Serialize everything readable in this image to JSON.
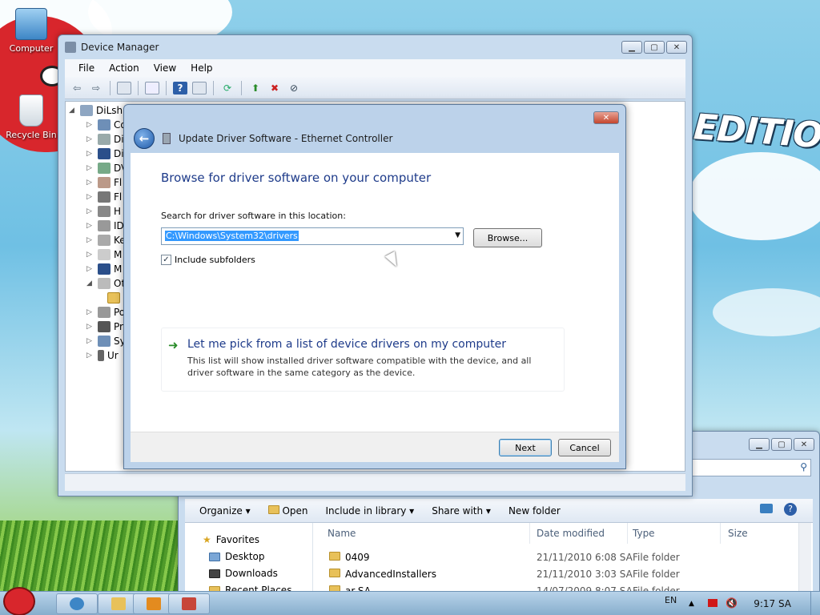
{
  "desktop": {
    "icons": [
      {
        "label": "Computer"
      },
      {
        "label": "Recycle Bin"
      }
    ],
    "wallpaper_text": "EDITION"
  },
  "device_manager": {
    "title": "Device Manager",
    "menu": [
      "File",
      "Action",
      "View",
      "Help"
    ],
    "root_label": "DiLsh",
    "tree_items": [
      "Co",
      "Di",
      "Di",
      "DV",
      "Fl",
      "Fl",
      "H",
      "ID",
      "Ke",
      "M",
      "M",
      "Ot",
      "",
      "Po",
      "Pr",
      "Sy",
      "Ur"
    ]
  },
  "dialog": {
    "title": "Update Driver Software - Ethernet Controller",
    "heading": "Browse for driver software on your computer",
    "search_label": "Search for driver software in this location:",
    "path_value": "C:\\Windows\\System32\\drivers",
    "browse_label": "Browse...",
    "include_subfolders_label": "Include subfolders",
    "include_subfolders_checked": true,
    "pick_link_title": "Let me pick from a list of device drivers on my computer",
    "pick_link_desc": "This list will show installed driver software compatible with the device, and all driver software in the same category as the device.",
    "next_label": "Next",
    "cancel_label": "Cancel"
  },
  "explorer": {
    "commands": [
      "Organize",
      "Open",
      "Include in library",
      "Share with",
      "New folder"
    ],
    "nav": [
      {
        "label": "Favorites"
      },
      {
        "label": "Desktop"
      },
      {
        "label": "Downloads"
      },
      {
        "label": "Recent Places"
      }
    ],
    "columns": [
      "Name",
      "Date modified",
      "Type",
      "Size"
    ],
    "rows": [
      {
        "name": "0409",
        "date": "21/11/2010 6:08 SA",
        "type": "File folder"
      },
      {
        "name": "AdvancedInstallers",
        "date": "21/11/2010 3:03 SA",
        "type": "File folder"
      },
      {
        "name": "ar-SA",
        "date": "14/07/2009 8:07 SA",
        "type": "File folder"
      }
    ]
  },
  "taskbar": {
    "language": "EN",
    "time": "9:17 SA"
  },
  "colors": {
    "accent_link": "#1e3b8a",
    "selection": "#3399ff",
    "close_button": "#c4462e"
  }
}
